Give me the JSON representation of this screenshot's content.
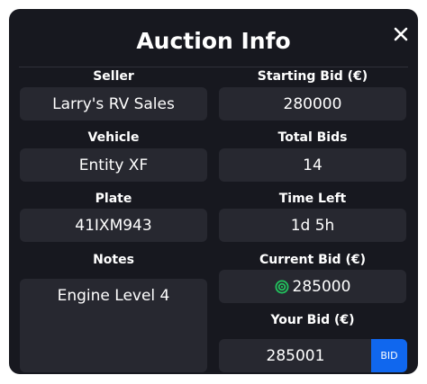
{
  "modal": {
    "title": "Auction Info",
    "close_icon": "close-icon"
  },
  "fields": {
    "seller": {
      "label": "Seller",
      "value": "Larry's RV Sales"
    },
    "starting_bid": {
      "label": "Starting Bid (€)",
      "value": "280000"
    },
    "vehicle": {
      "label": "Vehicle",
      "value": "Entity XF"
    },
    "total_bids": {
      "label": "Total Bids",
      "value": "14"
    },
    "plate": {
      "label": "Plate",
      "value": "41IXM943"
    },
    "time_left": {
      "label": "Time Left",
      "value": "1d 5h"
    },
    "notes": {
      "label": "Notes",
      "value": "Engine Level 4"
    },
    "current_bid": {
      "label": "Current Bid (€)",
      "value": "285000",
      "icon": "green-circle-icon"
    }
  },
  "your_bid": {
    "label": "Your Bid (€)",
    "value": "285001",
    "button_label": "BID"
  },
  "colors": {
    "background": "#17181f",
    "field": "#272830",
    "accent": "#1067ee",
    "coin": "#22c55e"
  }
}
